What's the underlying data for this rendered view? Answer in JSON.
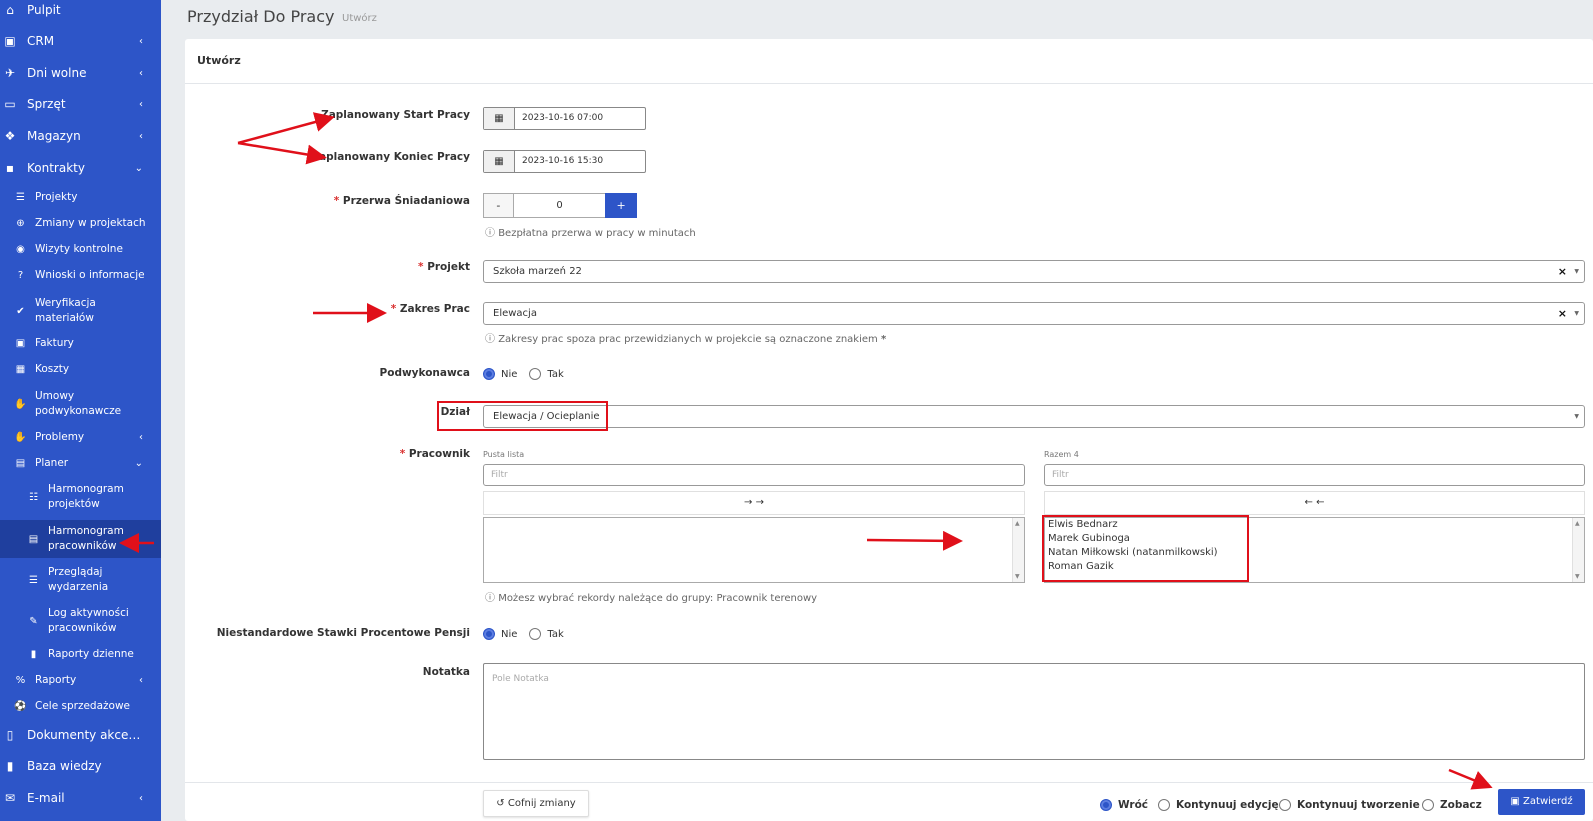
{
  "sidebar": {
    "items": [
      {
        "label": "Pulpit",
        "icon": "home-icon"
      },
      {
        "label": "CRM",
        "icon": "address-card-icon"
      },
      {
        "label": "Dni wolne",
        "icon": "plane-icon"
      },
      {
        "label": "Sprzęt",
        "icon": "hdd-icon"
      },
      {
        "label": "Magazyn",
        "icon": "cubes-icon"
      },
      {
        "label": "Kontrakty",
        "icon": "briefcase-icon"
      },
      {
        "label": "Projekty",
        "icon": "table-icon"
      },
      {
        "label": "Zmiany w projektach",
        "icon": "plus-circle-icon"
      },
      {
        "label": "Wizyty kontrolne",
        "icon": "eye-icon"
      },
      {
        "label": "Wnioski o informacje",
        "icon": "question-circle-icon"
      },
      {
        "label": "Weryfikacja materiałów",
        "line1": "Weryfikacja",
        "line2": "materiałów",
        "icon": "check-icon"
      },
      {
        "label": "Faktury",
        "icon": "money-bill-icon"
      },
      {
        "label": "Koszty",
        "icon": "calculator-icon"
      },
      {
        "label": "Umowy podwykonawcze",
        "line1": "Umowy",
        "line2": "podwykonawcze",
        "icon": "handshake-icon"
      },
      {
        "label": "Problemy",
        "icon": "hand-paper-icon"
      },
      {
        "label": "Planer",
        "icon": "calendar-icon"
      },
      {
        "label": "Harmonogram projektów",
        "line1": "Harmonogram",
        "line2": "projektów",
        "icon": "sliders-icon"
      },
      {
        "label": "Harmonogram pracowników",
        "line1": "Harmonogram",
        "line2": "pracowników",
        "icon": "calendar-alt-icon"
      },
      {
        "label": "Przeglądaj wydarzenia",
        "line1": "Przeglądaj",
        "line2": "wydarzenia",
        "icon": "list-icon"
      },
      {
        "label": "Log aktywności pracowników",
        "line1": "Log aktywności",
        "line2": "pracowników",
        "icon": "edit-icon"
      },
      {
        "label": "Raporty dzienne",
        "icon": "book-icon"
      },
      {
        "label": "Raporty",
        "icon": "percent-icon"
      },
      {
        "label": "Cele sprzedażowe",
        "icon": "futbol-icon"
      },
      {
        "label": "Dokumenty akcept...",
        "icon": "file-icon"
      },
      {
        "label": "Baza wiedzy",
        "icon": "book-icon"
      },
      {
        "label": "E-mail",
        "icon": "envelope-icon"
      }
    ]
  },
  "header": {
    "title": "Przydział Do Pracy",
    "subtitle": "Utwórz"
  },
  "card": {
    "title": "Utwórz"
  },
  "form": {
    "start_label": "Zaplanowany Start Pracy",
    "start_value": "2023-10-16 07:00",
    "end_label": "Zaplanowany Koniec Pracy",
    "end_value": "2023-10-16 15:30",
    "break_label": "Przerwa Śniadaniowa",
    "break_minus": "-",
    "break_value": "0",
    "break_plus": "+",
    "break_help": "Bezpłatna przerwa w pracy w minutach",
    "project_label": "Projekt",
    "project_value": "Szkoła marzeń 22",
    "scope_label": "Zakres Prac",
    "scope_value": "Elewacja",
    "scope_help": "Zakresy prac spoza prac przewidzianych w projekcie są oznaczone znakiem",
    "scope_help_mark": "*",
    "subcontractor_label": "Podwykonawca",
    "radio_no": "Nie",
    "radio_yes": "Tak",
    "dept_label": "Dział",
    "dept_value": "Elewacja / Ocieplanie",
    "worker_label": "Pracownik",
    "left_caption": "Pusta lista",
    "right_caption": "Razem 4",
    "filter_placeholder": "Filtr",
    "move_right": "→ →",
    "move_left": "← ←",
    "selected_workers": [
      "Elwis Bednarz",
      "Marek Gubinoga",
      "Natan Miłkowski (natanmilkowski)",
      "Roman Gazik"
    ],
    "worker_help": "Możesz wybrać rekordy należące do grupy: Pracownik terenowy",
    "rates_label": "Niestandardowe Stawki Procentowe Pensji",
    "note_label": "Notatka",
    "note_placeholder": "Pole Notatka",
    "required_mark": "*"
  },
  "footer": {
    "reset_label": "Cofnij zmiany",
    "options": [
      "Wróć",
      "Kontynuuj edycję",
      "Kontynuuj tworzenie",
      "Zobacz"
    ],
    "submit_label": "Zatwierdź"
  },
  "colors": {
    "sidebar": "#2d55c8",
    "sidebar_active": "#1f3f9e",
    "primary": "#2d55c8",
    "annotation": "#e0101a",
    "required": "#d9302f"
  }
}
